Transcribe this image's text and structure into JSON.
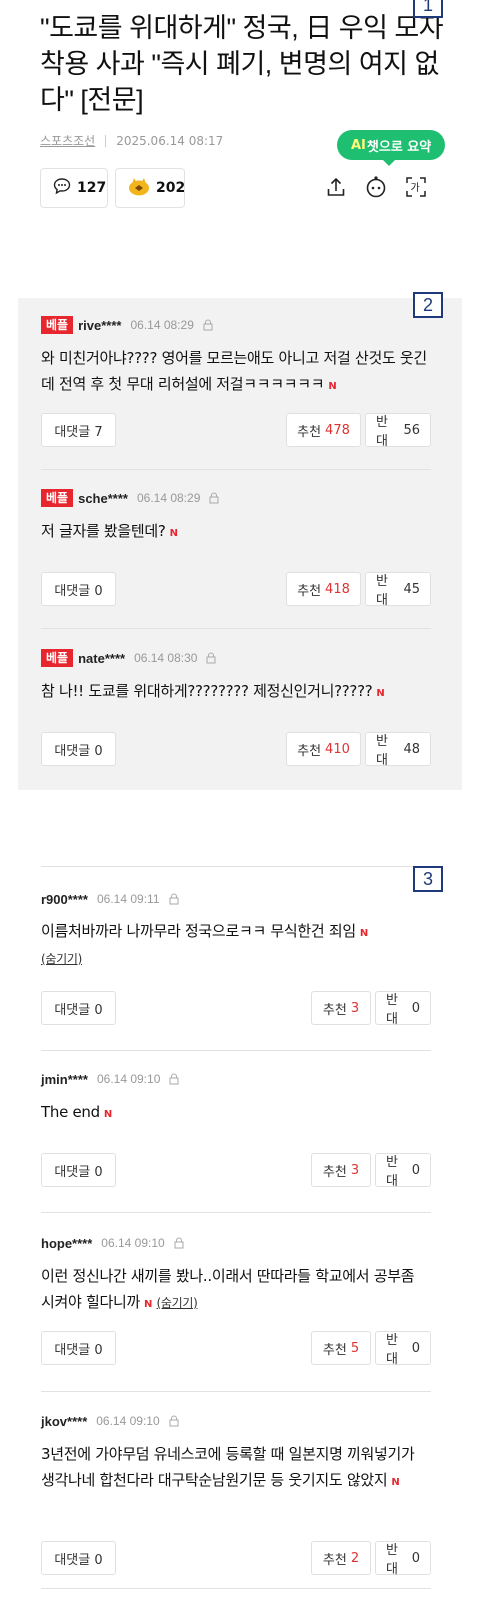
{
  "markers": [
    "1",
    "2",
    "3"
  ],
  "article": {
    "title": "\"도쿄를 위대하게\" 정국, 日 우익 모자 착용 사과 \"즉시 폐기, 변명의 여지 없다\" [전문]",
    "source": "스포츠조선",
    "datetime": "2025.06.14 08:17",
    "ai_badge_prefix": "AI",
    "ai_badge_suffix": "챗으로 요약",
    "comment_count": "127",
    "reaction_count": "202",
    "icons": [
      "comment-icon",
      "reaction-icon",
      "share-icon",
      "bot-icon",
      "font-size-icon"
    ]
  },
  "best_tag": "베플",
  "best_comments": [
    {
      "nick": "rive****",
      "time": "06.14 08:29",
      "text": "와 미친거아냐???? 영어를 모르는애도 아니고 저걸 산것도 웃긴데 전역 후 첫 무대 리허설에 저걸ㅋㅋㅋㅋㅋㅋ",
      "replies_label": "대댓글 7",
      "up_label": "추천",
      "up": "478",
      "down_label": "반대",
      "down": "56"
    },
    {
      "nick": "sche****",
      "time": "06.14 08:29",
      "text": "저 글자를 봤을텐데?",
      "replies_label": "대댓글 0",
      "up_label": "추천",
      "up": "418",
      "down_label": "반대",
      "down": "45"
    },
    {
      "nick": "nate****",
      "time": "06.14 08:30",
      "text": "참 나!! 도쿄를 위대하게???????? 제정신인거니?????",
      "replies_label": "대댓글 0",
      "up_label": "추천",
      "up": "410",
      "down_label": "반대",
      "down": "48"
    }
  ],
  "comments": [
    {
      "nick": "r900****",
      "time": "06.14 09:11",
      "text": "이름처바까라  나까무라  정국으로ㅋㅋ  무식한건  죄임",
      "hide_label": "(숨기기)",
      "replies_label": "대댓글 0",
      "up_label": "추천",
      "up": "3",
      "down_label": "반대",
      "down": "0"
    },
    {
      "nick": "jmin****",
      "time": "06.14 09:10",
      "text": "The end",
      "replies_label": "대댓글 0",
      "up_label": "추천",
      "up": "3",
      "down_label": "반대",
      "down": "0"
    },
    {
      "nick": "hope****",
      "time": "06.14 09:10",
      "text": "이런 정신나간 새끼를 봤나..이래서 딴따라들 학교에서 공부좀 시켜야 힐다니까",
      "hide_label": "(숨기기)",
      "replies_label": "대댓글 0",
      "up_label": "추천",
      "up": "5",
      "down_label": "반대",
      "down": "0"
    },
    {
      "nick": "jkov****",
      "time": "06.14 09:10",
      "text": "3년전에 가야무덤 유네스코에 등록할 때 일본지명 끼워넣기가 생각나네 합천다라 대구탁순남원기문 등 웃기지도 않았지",
      "replies_label": "대댓글 0",
      "up_label": "추천",
      "up": "2",
      "down_label": "반대",
      "down": "0"
    }
  ],
  "new_badge": "N"
}
